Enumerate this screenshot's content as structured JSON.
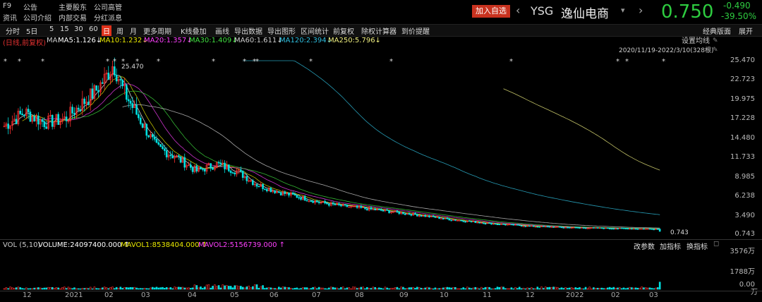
{
  "header": {
    "fkey": "F9",
    "row1_links": [
      "公告",
      "主要股东",
      "公司高管"
    ],
    "row2_links": [
      "资讯",
      "公司介绍",
      "内部交易",
      "分红派息"
    ],
    "add_button": "加入自选",
    "ticker": "YSG",
    "name": "逸仙电商",
    "price": "0.750",
    "change": "-0.490",
    "change_pct": "-39.50%"
  },
  "toolbar": {
    "items": [
      "分时",
      "5日",
      "5",
      "15",
      "30",
      "60",
      "日",
      "周",
      "月",
      "更多周期",
      "K线叠加",
      "画线",
      "导出数据",
      "导出图形",
      "区间统计",
      "前复权",
      "除权计算器",
      "到价提醒"
    ],
    "selected_index": 6,
    "right_items": [
      "经典版面",
      "展开"
    ]
  },
  "ma_legend": {
    "prefix": "(日线,前复权)",
    "label": "MA",
    "items": [
      {
        "text": "MA5:1.126↓",
        "color": "#ffffff"
      },
      {
        "text": "MA10:1.232↓",
        "color": "#e8e800"
      },
      {
        "text": "MA20:1.357↓",
        "color": "#ff40ff"
      },
      {
        "text": "MA30:1.409↓",
        "color": "#40e040"
      },
      {
        "text": "MA60:1.611↓",
        "color": "#d0d0d0"
      },
      {
        "text": "MA120:2.394↓",
        "color": "#30c0e0"
      },
      {
        "text": "MA250:5.796↓",
        "color": "#f0f080"
      }
    ],
    "settings": "设置均线",
    "range": "2020/11/19-2022/3/10(328根)"
  },
  "price_axis": [
    "25.470",
    "22.723",
    "19.975",
    "17.228",
    "14.480",
    "11.733",
    "8.985",
    "6.238",
    "3.490",
    "0.743"
  ],
  "annotations": {
    "high": "25.470",
    "low": "0.743"
  },
  "volume_legend": {
    "label": "VOL (5,10)",
    "volume": "VOLUME:24097400.000 ↑",
    "mavol1": "MAVOL1:8538404.000 ↑",
    "mavol2": "MAVOL2:5156739.000 ↑",
    "buttons": [
      "改参数",
      "加指标",
      "换指标"
    ]
  },
  "volume_axis": [
    "3576万",
    "1788万",
    "0.00"
  ],
  "volume_unit": "万",
  "x_axis": [
    "12",
    "2021",
    "02",
    "03",
    "04",
    "05",
    "06",
    "07",
    "08",
    "09",
    "10",
    "11",
    "12",
    "2022",
    "02",
    "03"
  ],
  "colors": {
    "up": "#ff3030",
    "down": "#00e0e0",
    "accent": "#e0331c",
    "price": "#2ecc40"
  }
}
